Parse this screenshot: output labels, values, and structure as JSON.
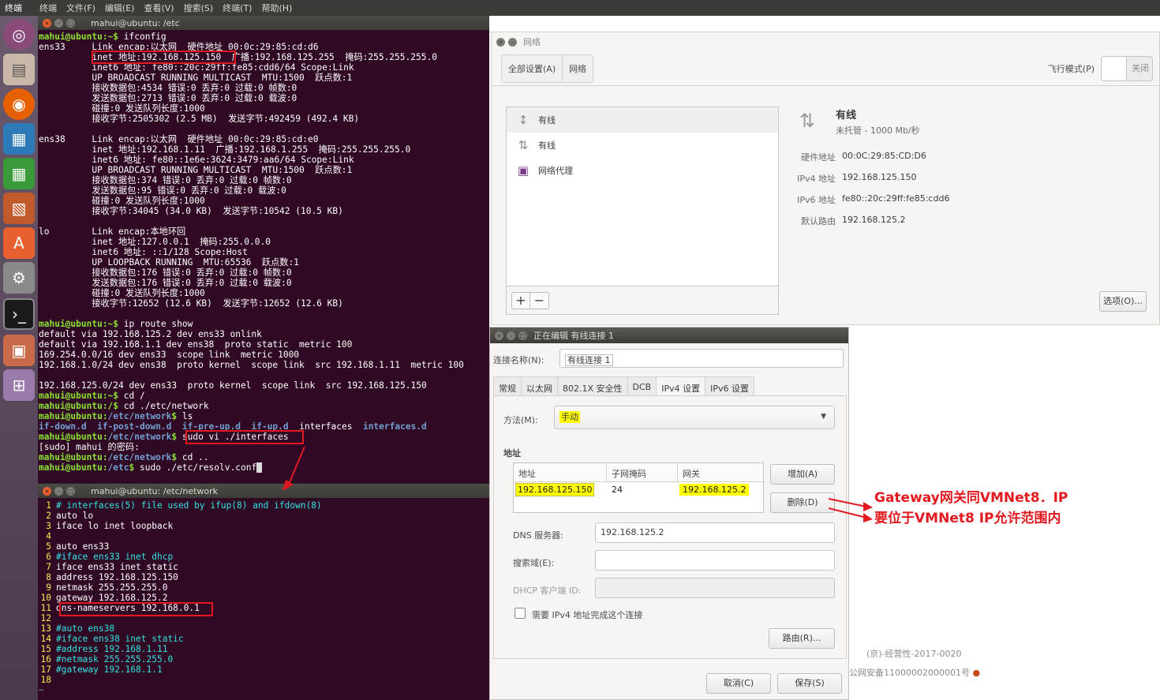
{
  "menubar": {
    "app": "终端",
    "items": [
      "终端",
      "文件(F)",
      "编辑(E)",
      "查看(V)",
      "搜索(S)",
      "终端(T)",
      "帮助(H)"
    ]
  },
  "term1": {
    "title": "mahui@ubuntu: /etc",
    "lines": [
      {
        "p": "mahui@ubuntu:~$ ",
        "t": "ifconfig"
      },
      {
        "t": "ens33     Link encap:以太网  硬件地址 00:0c:29:85:cd:d6"
      },
      {
        "t": "          inet 地址:192.168.125.150  广播:192.168.125.255  掩码:255.255.255.0"
      },
      {
        "t": "          inet6 地址: fe80::20c:29ff:fe85:cdd6/64 Scope:Link"
      },
      {
        "t": "          UP BROADCAST RUNNING MULTICAST  MTU:1500  跃点数:1"
      },
      {
        "t": "          接收数据包:4534 错误:0 丢弃:0 过载:0 帧数:0"
      },
      {
        "t": "          发送数据包:2713 错误:0 丢弃:0 过载:0 载波:0"
      },
      {
        "t": "          碰撞:0 发送队列长度:1000"
      },
      {
        "t": "          接收字节:2505302 (2.5 MB)  发送字节:492459 (492.4 KB)"
      },
      {
        "t": ""
      },
      {
        "t": "ens38     Link encap:以太网  硬件地址 00:0c:29:85:cd:e0"
      },
      {
        "t": "          inet 地址:192.168.1.11  广播:192.168.1.255  掩码:255.255.255.0"
      },
      {
        "t": "          inet6 地址: fe80::1e6e:3624:3479:aa6/64 Scope:Link"
      },
      {
        "t": "          UP BROADCAST RUNNING MULTICAST  MTU:1500  跃点数:1"
      },
      {
        "t": "          接收数据包:374 错误:0 丢弃:0 过载:0 帧数:0"
      },
      {
        "t": "          发送数据包:95 错误:0 丢弃:0 过载:0 载波:0"
      },
      {
        "t": "          碰撞:0 发送队列长度:1000"
      },
      {
        "t": "          接收字节:34045 (34.0 KB)  发送字节:10542 (10.5 KB)"
      },
      {
        "t": ""
      },
      {
        "t": "lo        Link encap:本地环回"
      },
      {
        "t": "          inet 地址:127.0.0.1  掩码:255.0.0.0"
      },
      {
        "t": "          inet6 地址: ::1/128 Scope:Host"
      },
      {
        "t": "          UP LOOPBACK RUNNING  MTU:65536  跃点数:1"
      },
      {
        "t": "          接收数据包:176 错误:0 丢弃:0 过载:0 帧数:0"
      },
      {
        "t": "          发送数据包:176 错误:0 丢弃:0 过载:0 载波:0"
      },
      {
        "t": "          碰撞:0 发送队列长度:1000"
      },
      {
        "t": "          接收字节:12652 (12.6 KB)  发送字节:12652 (12.6 KB)"
      },
      {
        "t": ""
      },
      {
        "p": "mahui@ubuntu:~$ ",
        "t": "ip route show"
      },
      {
        "t": "default via 192.168.125.2 dev ens33 onlink"
      },
      {
        "t": "default via 192.168.1.1 dev ens38  proto static  metric 100"
      },
      {
        "t": "169.254.0.0/16 dev ens33  scope link  metric 1000"
      },
      {
        "t": "192.168.1.0/24 dev ens38  proto kernel  scope link  src 192.168.1.11  metric 100"
      },
      {
        "t": ""
      },
      {
        "t": "192.168.125.0/24 dev ens33  proto kernel  scope link  src 192.168.125.150"
      },
      {
        "p": "mahui@ubuntu:~$ ",
        "t": "cd /"
      },
      {
        "p": "mahui@ubuntu:/$ ",
        "t": "cd ./etc/network"
      },
      {
        "p": "mahui@ubuntu:",
        "d": "/etc/network",
        "q": "$ ",
        "t": "ls"
      },
      {
        "ls": true
      },
      {
        "p": "mahui@ubuntu:",
        "d": "/etc/network",
        "q": "$ ",
        "t": "sudo vi ./interfaces"
      },
      {
        "t": "[sudo] mahui 的密码:"
      },
      {
        "p": "mahui@ubuntu:",
        "d": "/etc/network",
        "q": "$ ",
        "t": "cd .."
      },
      {
        "p": "mahui@ubuntu:",
        "d": "/etc",
        "q": "$ ",
        "t": "sudo ./etc/resolv.conf"
      }
    ],
    "ls_items": [
      {
        "name": "if-down.d",
        "dir": true
      },
      {
        "name": "if-post-down.d",
        "dir": true
      },
      {
        "name": "if-pre-up.d",
        "dir": true
      },
      {
        "name": "if-up.d",
        "dir": true
      },
      {
        "name": "interfaces",
        "dir": false
      },
      {
        "name": "interfaces.d",
        "dir": true
      }
    ]
  },
  "term2": {
    "title": "mahui@ubuntu: /etc/network",
    "lines": [
      {
        "n": "1",
        "t": "# interfaces(5) file used by ifup(8) and ifdown(8)",
        "c": true
      },
      {
        "n": "2",
        "t": "auto lo"
      },
      {
        "n": "3",
        "t": "iface lo inet loopback"
      },
      {
        "n": "4",
        "t": ""
      },
      {
        "n": "5",
        "t": "auto ens33"
      },
      {
        "n": "6",
        "t": "#iface ens33 inet dhcp",
        "c": true
      },
      {
        "n": "7",
        "t": "iface ens33 inet static"
      },
      {
        "n": "8",
        "t": "address 192.168.125.150"
      },
      {
        "n": "9",
        "t": "netmask 255.255.255.0"
      },
      {
        "n": "10",
        "t": "gateway 192.168.125.2"
      },
      {
        "n": "11",
        "t": "dns-nameservers 192.168.0.1"
      },
      {
        "n": "12",
        "t": ""
      },
      {
        "n": "13",
        "t": "#auto ens38",
        "c": true
      },
      {
        "n": "14",
        "t": "#iface ens38 inet static",
        "c": true
      },
      {
        "n": "15",
        "t": "#address 192.168.1.11",
        "c": true
      },
      {
        "n": "16",
        "t": "#netmask 255.255.255.0",
        "c": true
      },
      {
        "n": "17",
        "t": "#gateway 192.168.1.1",
        "c": true
      },
      {
        "n": "18",
        "t": ""
      },
      {
        "n": "~",
        "t": ""
      }
    ]
  },
  "network": {
    "title": "网络",
    "crumbs": [
      "全部设置(A)",
      "网络"
    ],
    "airplane_label": "飞行模式(P)",
    "toggle_label": "关闭",
    "list": [
      {
        "label": "有线",
        "icon": "↕"
      },
      {
        "label": "有线",
        "icon": "⇅"
      },
      {
        "label": "网络代理",
        "icon": "▣"
      }
    ],
    "add": "+",
    "remove": "−",
    "detail": {
      "title": "有线",
      "subtitle": "未托管 - 1000 Mb/秒",
      "rows": [
        {
          "k": "硬件地址",
          "v": "00:0C:29:85:CD:D6"
        },
        {
          "k": "IPv4 地址",
          "v": "192.168.125.150"
        },
        {
          "k": "IPv6 地址",
          "v": "fe80::20c:29ff:fe85:cdd6"
        },
        {
          "k": "默认路由",
          "v": "192.168.125.2"
        }
      ]
    },
    "options_button": "选项(O)..."
  },
  "dialog": {
    "title": "正在编辑 有线连接 1",
    "name_label": "连接名称(N):",
    "name_value": "有线连接 1",
    "tabs": [
      "常规",
      "以太网",
      "802.1X 安全性",
      "DCB",
      "IPv4 设置",
      "IPv6 设置"
    ],
    "method_label": "方法(M):",
    "method_value": "手动",
    "address_section": "地址",
    "columns": [
      "地址",
      "子网掩码",
      "网关"
    ],
    "row": [
      "192.168.125.150",
      "24",
      "192.168.125.2"
    ],
    "add_button": "增加(A)",
    "delete_button": "删除(D)",
    "dns_label": "DNS 服务器:",
    "dns_value": "192.168.125.2",
    "search_label": "搜索域(E):",
    "dhcp_label": "DHCP 客户端 ID:",
    "require_label": "需要 IPv4 地址完成这个连接",
    "routes_button": "路由(R)...",
    "cancel": "取消(C)",
    "save": "保存(S)"
  },
  "annotation": {
    "line1": "Gateway网关同VMNet8．IP",
    "line2": "要位于VMNet8 IP允许范围内"
  },
  "footer": {
    "line1": "(京)-经营性-2017-0020",
    "line2": "公网安备11000002000001号"
  },
  "colors": {
    "mark": "#e3191f",
    "highlight": "#ffff00",
    "terminal_bg": "#300a24"
  }
}
